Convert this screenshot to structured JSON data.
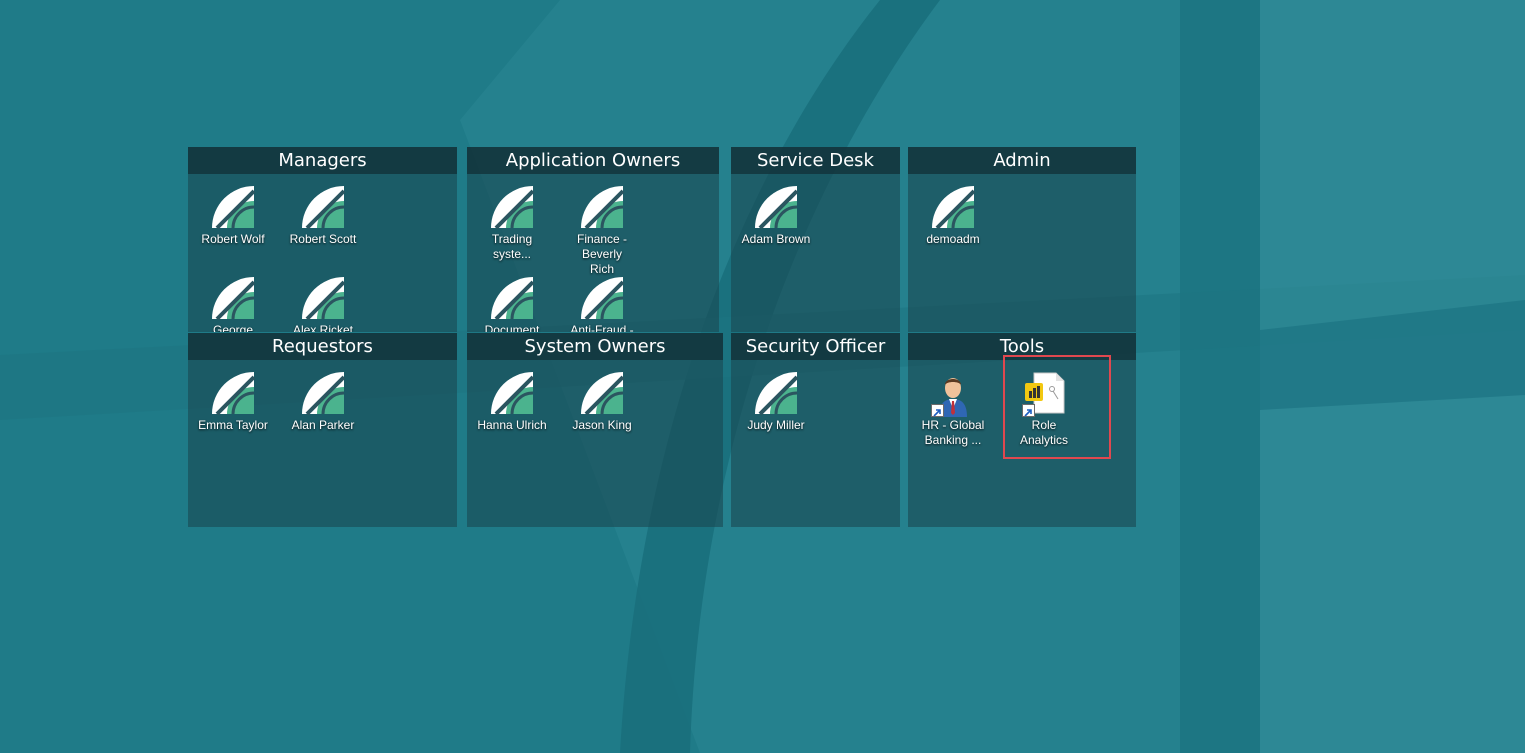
{
  "desktop": {
    "background_color": "#1f7b88",
    "highlight_color": "#e0484f"
  },
  "fences": {
    "managers": {
      "title": "Managers",
      "icons": [
        {
          "label": "Robert Wolf",
          "icon": "app-logo-icon"
        },
        {
          "label": "Robert Scott",
          "icon": "app-logo-icon"
        },
        {
          "label": "George",
          "icon": "app-logo-icon"
        },
        {
          "label": "Alex Ricket",
          "icon": "app-logo-icon"
        }
      ]
    },
    "application_owners": {
      "title": "Application Owners",
      "icons": [
        {
          "label": "Trading syste...",
          "icon": "app-logo-icon"
        },
        {
          "label": "Finance - Beverly Rich",
          "icon": "app-logo-icon"
        },
        {
          "label": "Document",
          "icon": "app-logo-icon"
        },
        {
          "label": "Anti-Fraud -",
          "icon": "app-logo-icon"
        }
      ]
    },
    "service_desk": {
      "title": "Service Desk",
      "icons": [
        {
          "label": "Adam Brown",
          "icon": "app-logo-icon"
        }
      ]
    },
    "admin": {
      "title": "Admin",
      "icons": [
        {
          "label": "demoadm",
          "icon": "app-logo-icon"
        }
      ]
    },
    "requestors": {
      "title": "Requestors",
      "icons": [
        {
          "label": "Emma Taylor",
          "icon": "app-logo-icon"
        },
        {
          "label": "Alan Parker",
          "icon": "app-logo-icon"
        }
      ]
    },
    "system_owners": {
      "title": "System Owners",
      "icons": [
        {
          "label": "Hanna Ulrich",
          "icon": "app-logo-icon"
        },
        {
          "label": "Jason King",
          "icon": "app-logo-icon"
        }
      ]
    },
    "security_officer": {
      "title": "Security Officer",
      "icons": [
        {
          "label": "Judy Miller",
          "icon": "app-logo-icon"
        }
      ]
    },
    "tools": {
      "title": "Tools",
      "icons": [
        {
          "label": "HR - Global Banking ...",
          "icon": "person-shortcut-icon"
        },
        {
          "label": "Role Analytics",
          "icon": "report-file-shortcut-icon"
        }
      ]
    }
  }
}
